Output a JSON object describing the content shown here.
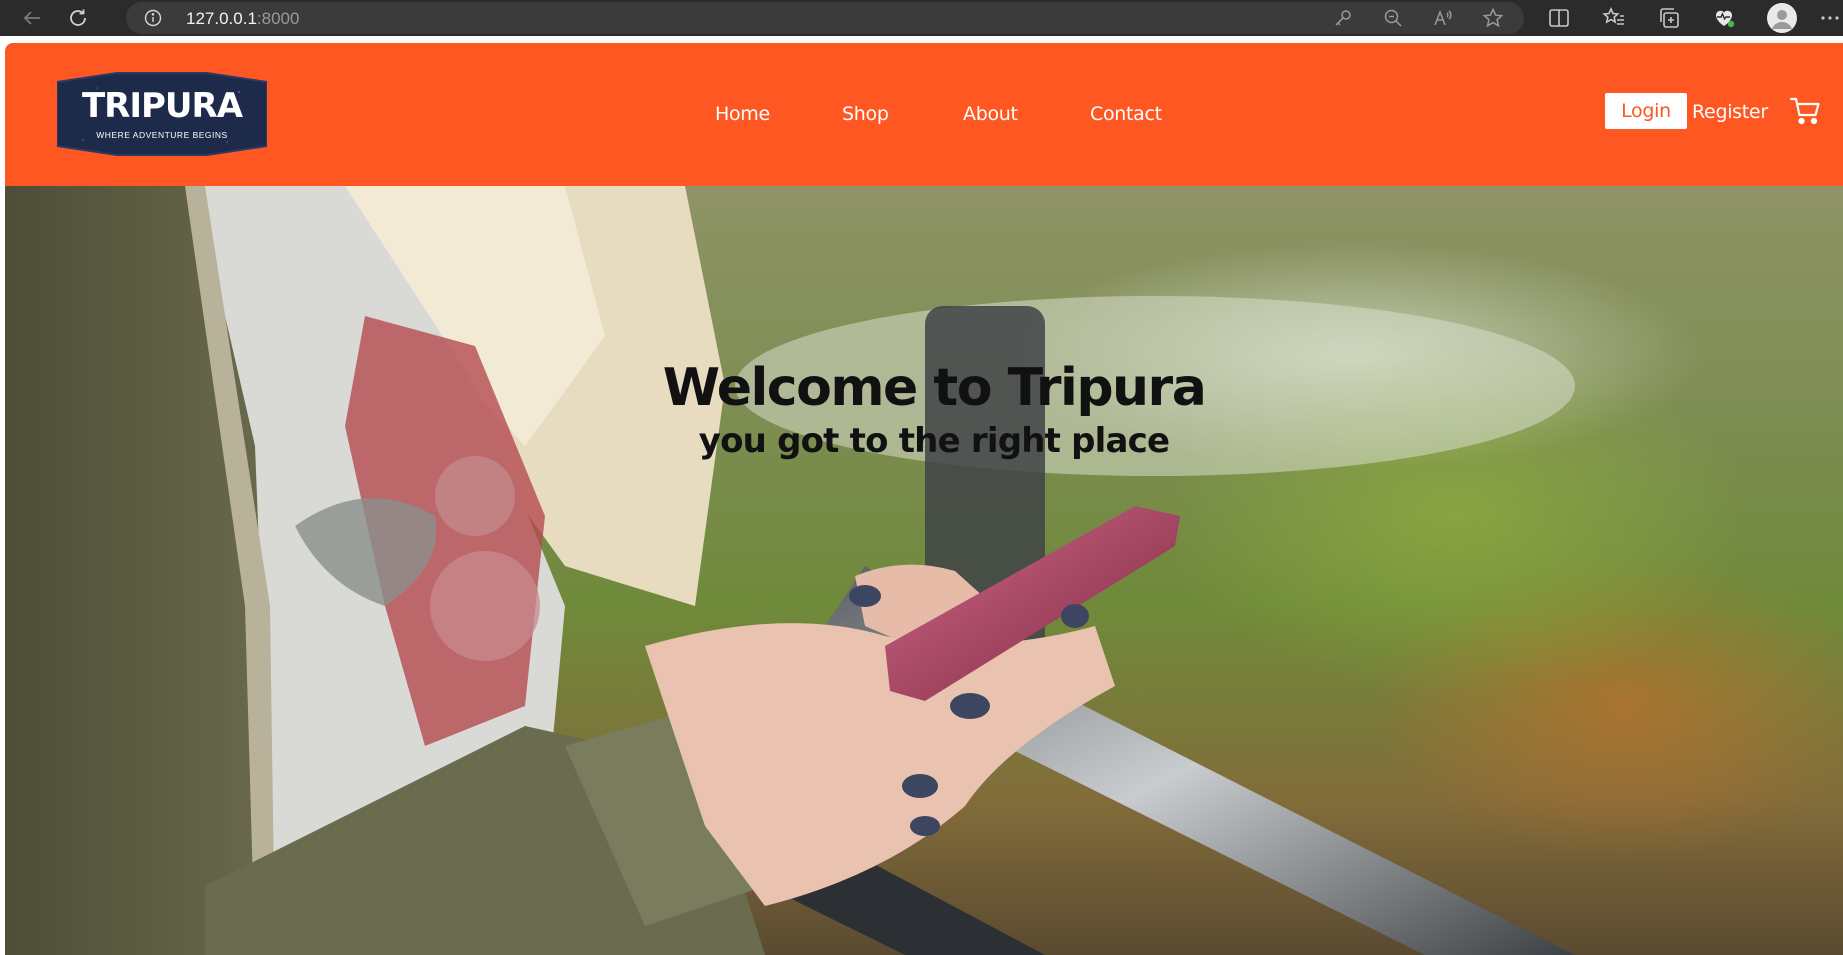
{
  "browser": {
    "url_host": "127.0.0.1",
    "url_port": ":8000",
    "icons": [
      "back-icon",
      "refresh-icon",
      "info-icon",
      "key-icon",
      "zoom-out-icon",
      "read-aloud-icon",
      "star-icon",
      "split-screen-icon",
      "favorites-icon",
      "collections-icon",
      "browser-essentials-icon",
      "profile-icon",
      "more-icon"
    ]
  },
  "header": {
    "logo_title": "TRIPURA",
    "logo_tagline": "WHERE ADVENTURE BEGINS",
    "nav": [
      {
        "label": "Home"
      },
      {
        "label": "Shop"
      },
      {
        "label": "About"
      },
      {
        "label": "Contact"
      }
    ],
    "login_label": "Login",
    "register_label": "Register",
    "cart_icon": "cart-icon"
  },
  "hero": {
    "title": "Welcome to Tripura",
    "subtitle": "you got to the right place"
  },
  "colors": {
    "brand": "#ff5722",
    "logo_badge": "#1e2a4a",
    "browser_chrome": "#2b2b2b"
  }
}
